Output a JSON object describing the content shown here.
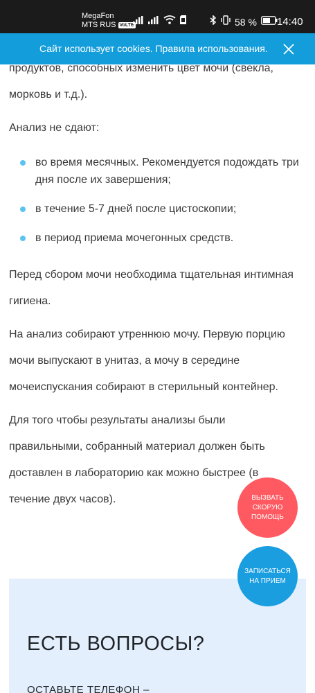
{
  "status_bar": {
    "carrier_name": "MegaFon",
    "carrier_network": "MTS RUS",
    "volte_badge": "VoLTE",
    "battery_percent": "58 %",
    "time": "14:40"
  },
  "cookie_banner": {
    "text": "Сайт использует cookies. Правила использования."
  },
  "article": {
    "paragraph_intro": "продуктов, способных изменить цвет мочи (свекла, морковь и т.д.).",
    "not_taken_heading": "Анализ не сдают:",
    "bullets": [
      "во время месячных. Рекомендуется подождать три дня после их завершения;",
      "в течение 5-7 дней после цистоскопии;",
      "в период приема мочегонных средств."
    ],
    "paragraph_hygiene": "Перед сбором мочи необходима тщательная интимная гигиена.",
    "paragraph_morning": "На анализ собирают утреннюю мочу. Первую порцию мочи выпускают в унитаз, а мочу в середине мочеиспускания собирают в стерильный контейнер.",
    "paragraph_delivery": "Для того чтобы результаты анализы были правильными, собранный материал должен быть доставлен в лабораторию как можно быстрее (в течение двух часов)."
  },
  "fab": {
    "ambulance_label": "ВЫЗВАТЬ СКОРУЮ ПОМОЩЬ",
    "appointment_label": "ЗАПИСАТЬСЯ НА ПРИЕМ"
  },
  "questions": {
    "title": "ЕСТЬ ВОПРОСЫ?",
    "subtitle": "ОСТАВЬТЕ ТЕЛЕФОН –"
  },
  "colors": {
    "banner": "#139ddb",
    "bullet": "#5cc3f0",
    "ambulance": "#ff5a61",
    "appointment": "#1a9ee0",
    "questions_bg": "#e3effc"
  }
}
